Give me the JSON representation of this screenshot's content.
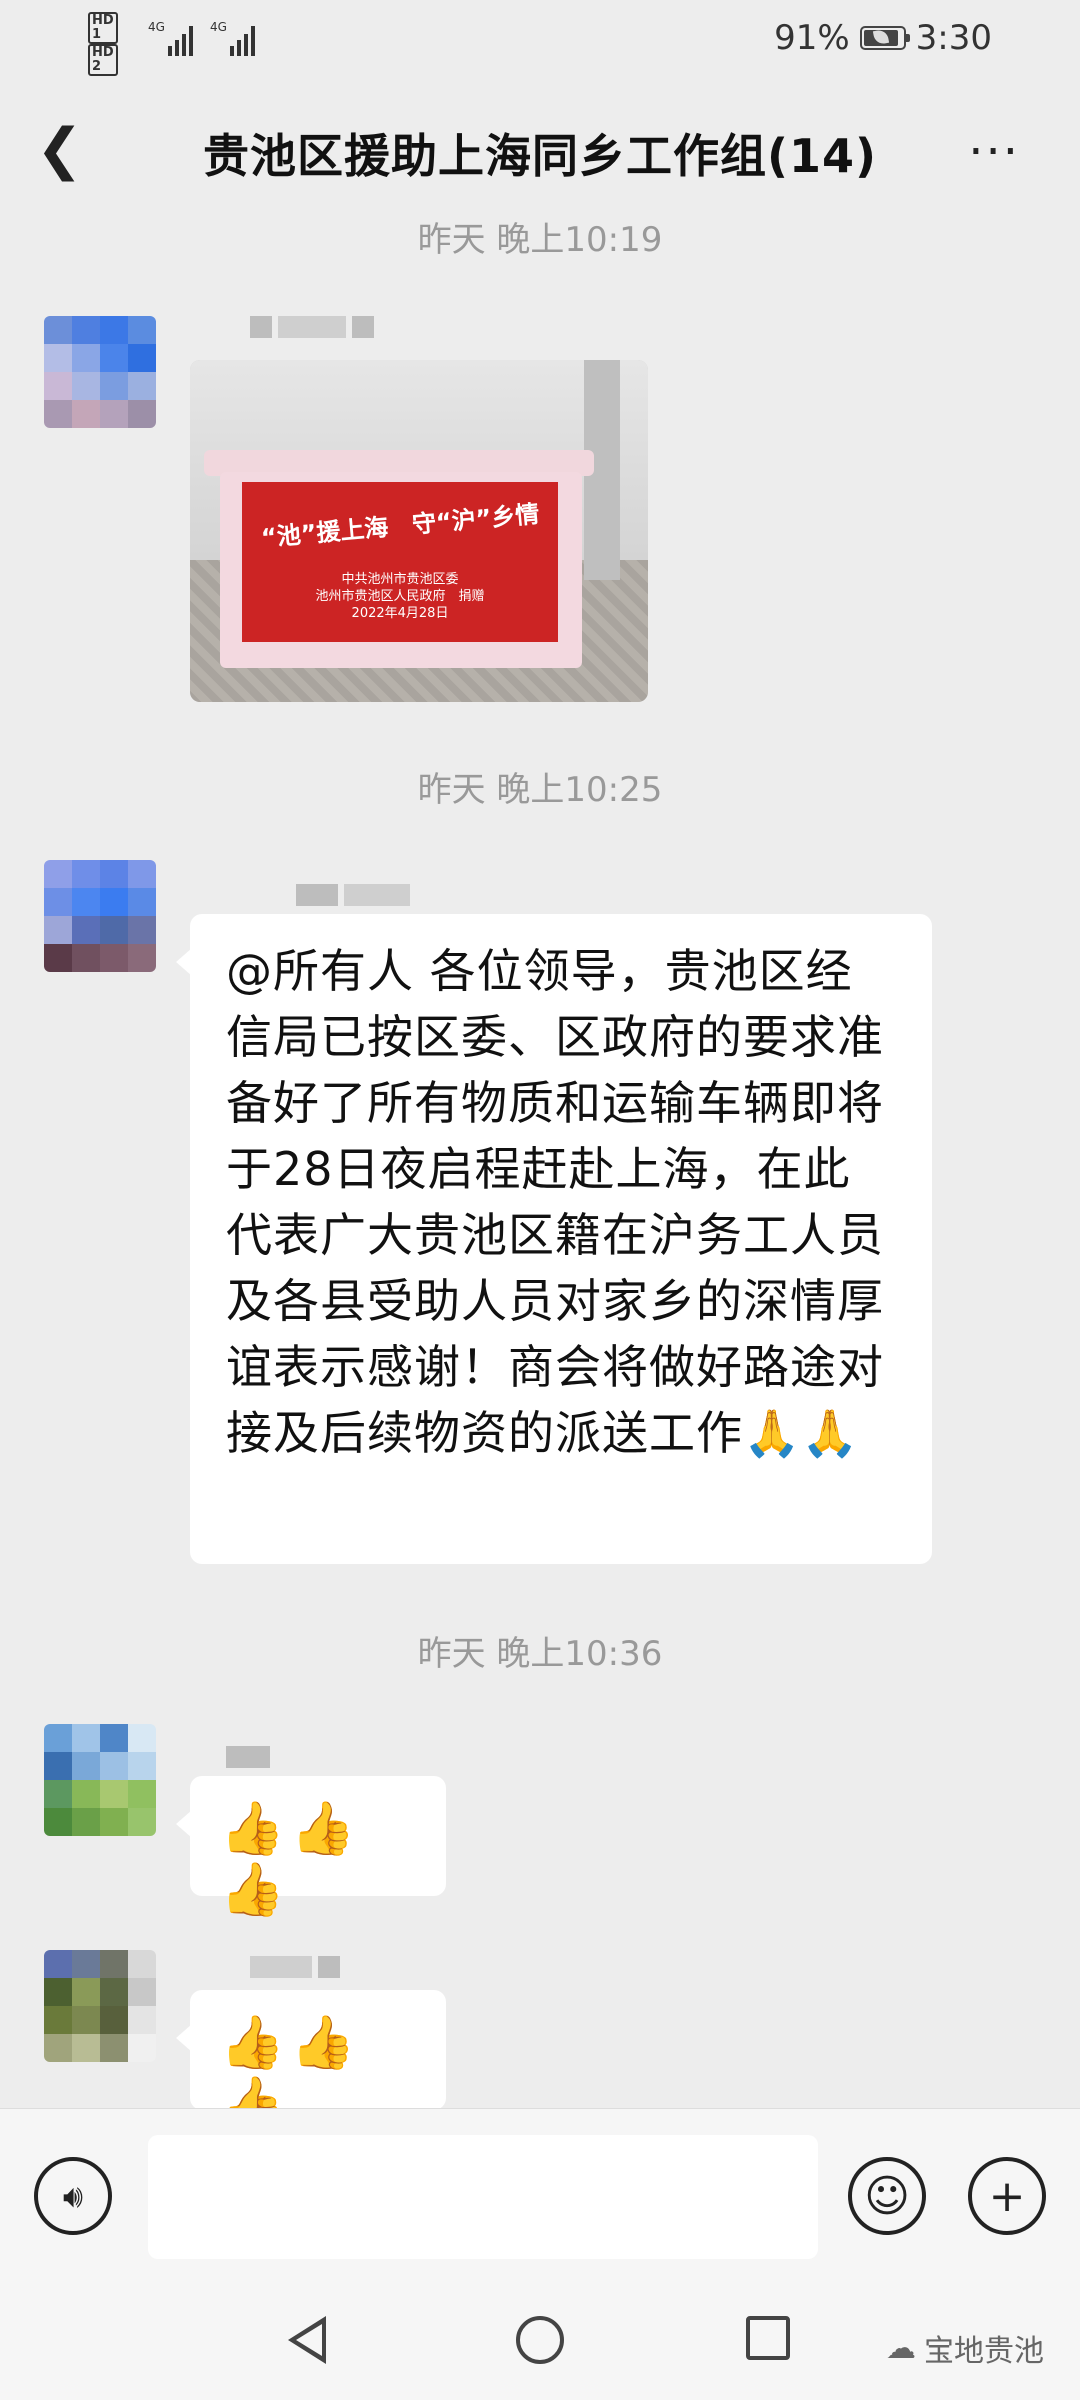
{
  "status_bar": {
    "sim1": "HD 1",
    "sim2": "HD 2",
    "net1": "4G",
    "net2": "4G",
    "battery": "91%",
    "time": "3:30"
  },
  "header": {
    "title": "贵池区援助上海同乡工作组(14)"
  },
  "messages": [
    {
      "timestamp": "昨天 晚上10:19"
    },
    {
      "photo_label_line1": "“池”援上海　守“沪”乡情",
      "photo_label_line2": "中共池州市贵池区委\n池州市贵池区人民政府　捐赠\n2022年4月28日"
    },
    {
      "timestamp": "昨天 晚上10:25"
    },
    {
      "text": "@所有人  各位领导，贵池区经信局已按区委、区政府的要求准备好了所有物质和运输车辆即将于28日夜启程赶赴上海，在此代表广大贵池区籍在沪务工人员及各县受助人员对家乡的深情厚谊表示感谢！商会将做好路途对接及后续物资的派送工作🙏🙏"
    },
    {
      "timestamp": "昨天 晚上10:36"
    },
    {
      "text": "👍👍👍"
    },
    {
      "text": "👍👍👍"
    }
  ],
  "input_bar": {
    "voice_icon": "voice-icon",
    "emoji_icon": "emoji-icon",
    "plus_icon": "plus-icon"
  },
  "watermark": "宝地贵池",
  "colors": {
    "background": "#ededed",
    "bubble": "#ffffff",
    "timestamp": "#999999"
  }
}
